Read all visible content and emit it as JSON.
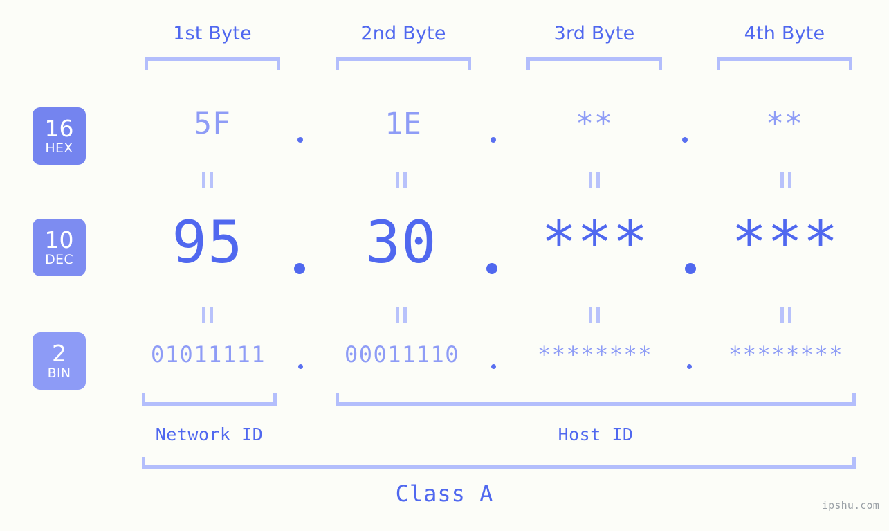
{
  "meta": {
    "background_color": "#fcfdf8",
    "accent_strong": "#5068ef",
    "accent_light": "#8e9cf6",
    "bracket_color": "#b3befc"
  },
  "headers": [
    {
      "label": "1st Byte"
    },
    {
      "label": "2nd Byte"
    },
    {
      "label": "3rd Byte"
    },
    {
      "label": "4th Byte"
    }
  ],
  "bases": [
    {
      "number": "16",
      "name": "HEX",
      "color": "#7484ef"
    },
    {
      "number": "10",
      "name": "DEC",
      "color": "#7d8cf1"
    },
    {
      "number": "2",
      "name": "BIN",
      "color": "#8d9bf6"
    }
  ],
  "rows": {
    "hex": {
      "values": [
        "5F",
        "1E",
        "**",
        "**"
      ],
      "separator": "."
    },
    "dec": {
      "values": [
        "95",
        "30",
        "***",
        "***"
      ],
      "separator": "."
    },
    "bin": {
      "values": [
        "01011111",
        "00011110",
        "********",
        "********"
      ],
      "separator": "."
    }
  },
  "equals_symbol": "=",
  "sections": [
    {
      "label": "Network ID"
    },
    {
      "label": "Host ID"
    }
  ],
  "class": {
    "label": "Class A"
  },
  "watermark": "ipshu.com"
}
